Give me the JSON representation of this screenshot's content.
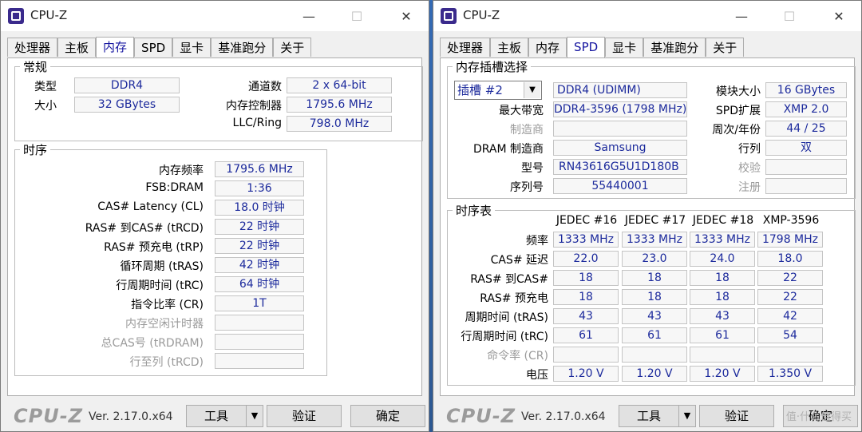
{
  "left": {
    "title": "CPU-Z",
    "tabs": [
      "处理器",
      "主板",
      "内存",
      "SPD",
      "显卡",
      "基准跑分",
      "关于"
    ],
    "general": {
      "legend": "常规",
      "type_label": "类型",
      "type_value": "DDR4",
      "size_label": "大小",
      "size_value": "32 GBytes",
      "channels_label": "通道数",
      "channels_value": "2 x 64-bit",
      "controller_label": "内存控制器",
      "controller_value": "1795.6 MHz",
      "llc_label": "LLC/Ring",
      "llc_value": "798.0 MHz"
    },
    "timings": {
      "legend": "时序",
      "rows": [
        {
          "label": "内存频率",
          "value": "1795.6 MHz"
        },
        {
          "label": "FSB:DRAM",
          "value": "1:36"
        },
        {
          "label": "CAS# Latency (CL)",
          "value": "18.0 时钟"
        },
        {
          "label": "RAS# 到CAS# (tRCD)",
          "value": "22 时钟"
        },
        {
          "label": "RAS# 预充电 (tRP)",
          "value": "22 时钟"
        },
        {
          "label": "循环周期 (tRAS)",
          "value": "42 时钟"
        },
        {
          "label": "行周期时间 (tRC)",
          "value": "64 时钟"
        },
        {
          "label": "指令比率 (CR)",
          "value": "1T"
        },
        {
          "label": "内存空闲计时器",
          "value": ""
        },
        {
          "label": "总CAS号 (tRDRAM)",
          "value": ""
        },
        {
          "label": "行至列 (tRCD)",
          "value": ""
        }
      ]
    },
    "footer": {
      "logo": "CPU-Z",
      "version": "Ver. 2.17.0.x64",
      "tools": "工具",
      "validate": "验证",
      "ok": "确定"
    }
  },
  "right": {
    "title": "CPU-Z",
    "tabs": [
      "处理器",
      "主板",
      "内存",
      "SPD",
      "显卡",
      "基准跑分",
      "关于"
    ],
    "slot": {
      "legend": "内存插槽选择",
      "slot_value": "插槽 #2",
      "module_type": "DDR4 (UDIMM)",
      "module_size_label": "模块大小",
      "module_size": "16 GBytes",
      "max_bw_label": "最大带宽",
      "max_bw": "DDR4-3596 (1798 MHz)",
      "spd_ext_label": "SPD扩展",
      "spd_ext": "XMP 2.0",
      "mfr_label": "制造商",
      "mfr": "",
      "week_year_label": "周次/年份",
      "week_year": "44 / 25",
      "dram_mfr_label": "DRAM 制造商",
      "dram_mfr": "Samsung",
      "rank_label": "行列",
      "rank": "双",
      "part_label": "型号",
      "part": "RN43616G5U1D180B",
      "check_label": "校验",
      "check": "",
      "serial_label": "序列号",
      "serial": "55440001",
      "reg_label": "注册",
      "reg": ""
    },
    "timing_table": {
      "legend": "时序表",
      "headers": [
        "JEDEC #16",
        "JEDEC #17",
        "JEDEC #18",
        "XMP-3596"
      ],
      "rows": [
        {
          "label": "频率",
          "values": [
            "1333 MHz",
            "1333 MHz",
            "1333 MHz",
            "1798 MHz"
          ]
        },
        {
          "label": "CAS# 延迟",
          "values": [
            "22.0",
            "23.0",
            "24.0",
            "18.0"
          ]
        },
        {
          "label": "RAS# 到CAS#",
          "values": [
            "18",
            "18",
            "18",
            "22"
          ]
        },
        {
          "label": "RAS# 预充电",
          "values": [
            "18",
            "18",
            "18",
            "22"
          ]
        },
        {
          "label": "周期时间 (tRAS)",
          "values": [
            "43",
            "43",
            "43",
            "42"
          ]
        },
        {
          "label": "行周期时间 (tRC)",
          "values": [
            "61",
            "61",
            "61",
            "54"
          ]
        },
        {
          "label": "命令率 (CR)",
          "values": [
            "",
            "",
            "",
            ""
          ]
        },
        {
          "label": "电压",
          "values": [
            "1.20 V",
            "1.20 V",
            "1.20 V",
            "1.350 V"
          ]
        }
      ]
    },
    "footer": {
      "logo": "CPU-Z",
      "version": "Ver. 2.17.0.x64",
      "tools": "工具",
      "validate": "验证",
      "ok": "确定",
      "watermark": "值·什么值得买"
    }
  }
}
